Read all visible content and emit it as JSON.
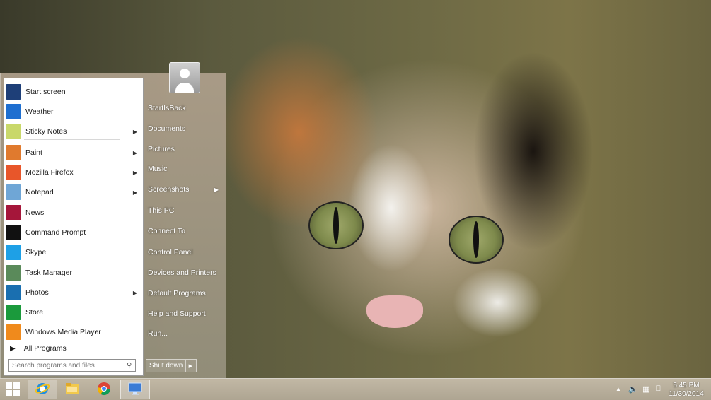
{
  "start_menu": {
    "programs": [
      {
        "label": "Start screen",
        "icon": "start-screen-icon",
        "color": "#1e3f78",
        "submenu": false
      },
      {
        "label": "Weather",
        "icon": "weather-icon",
        "color": "#1f6fd0",
        "submenu": false
      },
      {
        "label": "Sticky Notes",
        "icon": "sticky-notes-icon",
        "color": "#c9d86a",
        "submenu": true
      },
      {
        "label": "Paint",
        "icon": "paint-icon",
        "color": "#e07a2e",
        "submenu": true
      },
      {
        "label": "Mozilla Firefox",
        "icon": "firefox-icon",
        "color": "#e8562a",
        "submenu": true
      },
      {
        "label": "Notepad",
        "icon": "notepad-icon",
        "color": "#6fa6d6",
        "submenu": true
      },
      {
        "label": "News",
        "icon": "news-icon",
        "color": "#a5163a",
        "submenu": false
      },
      {
        "label": "Command Prompt",
        "icon": "command-prompt-icon",
        "color": "#111111",
        "submenu": false
      },
      {
        "label": "Skype",
        "icon": "skype-icon",
        "color": "#1ea0e6",
        "submenu": false
      },
      {
        "label": "Task Manager",
        "icon": "task-manager-icon",
        "color": "#5a8a5a",
        "submenu": false
      },
      {
        "label": "Photos",
        "icon": "photos-icon",
        "color": "#1a6fb0",
        "submenu": true
      },
      {
        "label": "Store",
        "icon": "store-icon",
        "color": "#1b9a3c",
        "submenu": false
      },
      {
        "label": "Windows Media Player",
        "icon": "media-player-icon",
        "color": "#f08a1c",
        "submenu": false
      }
    ],
    "all_programs": "All Programs",
    "search_placeholder": "Search programs and files",
    "places": [
      {
        "label": "StartIsBack",
        "submenu": false
      },
      {
        "label": "Documents",
        "submenu": false
      },
      {
        "label": "Pictures",
        "submenu": false
      },
      {
        "label": "Music",
        "submenu": false
      },
      {
        "label": "Screenshots",
        "submenu": true
      },
      {
        "label": "This PC",
        "submenu": false
      },
      {
        "label": "Connect To",
        "submenu": false
      },
      {
        "label": "Control Panel",
        "submenu": false
      },
      {
        "label": "Devices and Printers",
        "submenu": false
      },
      {
        "label": "Default Programs",
        "submenu": false
      },
      {
        "label": "Help and Support",
        "submenu": false
      },
      {
        "label": "Run...",
        "submenu": false
      }
    ],
    "shutdown_label": "Shut down"
  },
  "taskbar": {
    "pinned": [
      {
        "icon": "internet-explorer-icon",
        "active": true
      },
      {
        "icon": "file-explorer-icon",
        "active": false
      },
      {
        "icon": "chrome-icon",
        "active": false
      },
      {
        "icon": "remote-desktop-icon",
        "active": true
      }
    ],
    "tray_icons": [
      "show-hidden-icons-icon",
      "volume-icon",
      "network-icon",
      "action-center-icon"
    ],
    "clock": {
      "time": "5:45 PM",
      "date": "11/30/2014"
    }
  }
}
